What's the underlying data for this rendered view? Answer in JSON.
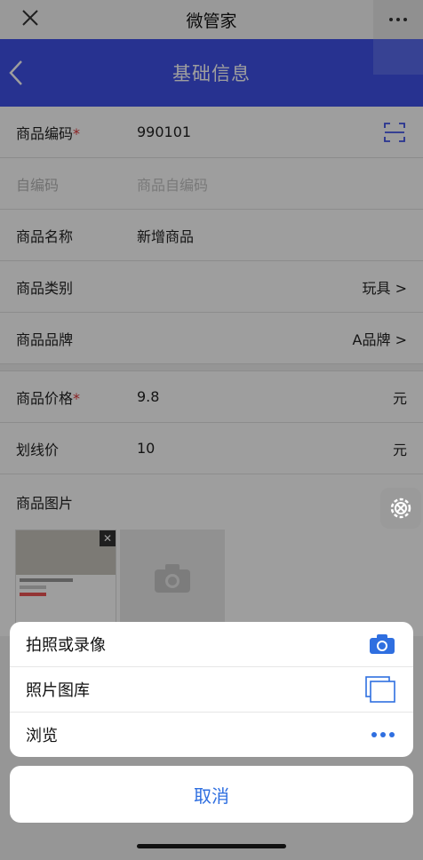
{
  "topbar": {
    "title": "微管家"
  },
  "header": {
    "title": "基础信息"
  },
  "form": {
    "code": {
      "label": "商品编码",
      "required_mark": "*",
      "value": "990101"
    },
    "self_code": {
      "label": "自编码",
      "placeholder": "商品自编码"
    },
    "name": {
      "label": "商品名称",
      "value": "新增商品"
    },
    "category": {
      "label": "商品类别",
      "value": "玩具 >"
    },
    "brand": {
      "label": "商品品牌",
      "value": "A品牌 >"
    },
    "price": {
      "label": "商品价格",
      "required_mark": "*",
      "value": "9.8",
      "unit": "元"
    },
    "strike_price": {
      "label": "划线价",
      "value": "10",
      "unit": "元"
    },
    "images": {
      "label": "商品图片"
    }
  },
  "sheet": {
    "items": [
      {
        "label": "拍照或录像",
        "icon": "camera-icon"
      },
      {
        "label": "照片图库",
        "icon": "gallery-icon"
      },
      {
        "label": "浏览",
        "icon": "more-dots-icon"
      }
    ],
    "cancel": "取消"
  },
  "colors": {
    "header": "#3f51e8",
    "accent": "#2f6fe0",
    "required": "#e0373a"
  }
}
